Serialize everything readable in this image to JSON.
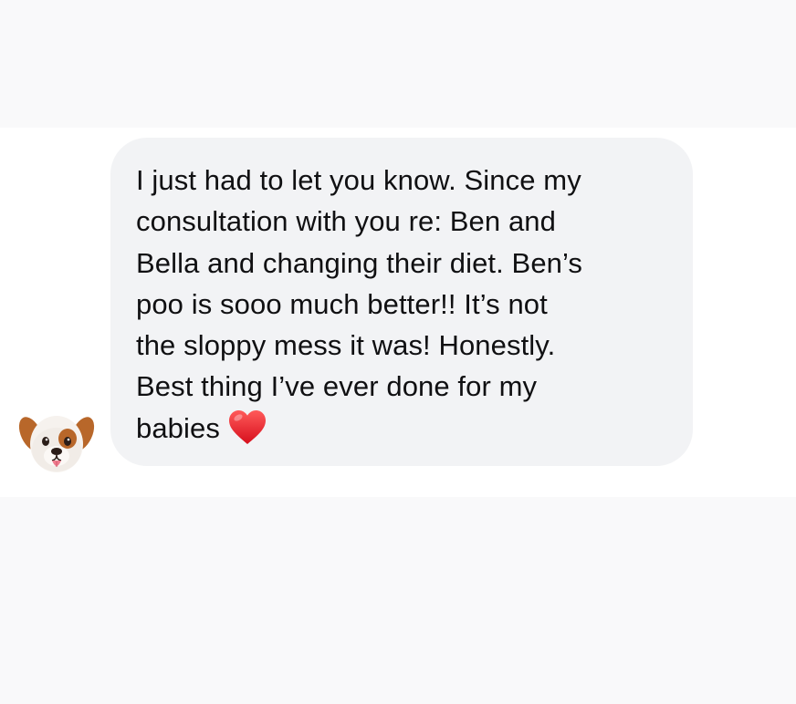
{
  "conversation": {
    "sender_avatar": {
      "icon": "dog-face-icon",
      "colors": {
        "fur_white": "#f6f2ee",
        "fur_brown": "#b8672a",
        "nose": "#2a1d18",
        "tongue": "#ef7c8e"
      }
    },
    "message": {
      "text": "I just had to let you know. Since my\nconsultation with you re: Ben and\nBella and changing their diet. Ben’s\npoo is sooo much better!!  It’s not\nthe sloppy mess it was!  Honestly.\nBest thing I’ve ever done for my\nbabies",
      "trailing_emoji": "red-heart-icon",
      "bubble_color": "#f2f3f5",
      "text_color": "#101012"
    }
  }
}
